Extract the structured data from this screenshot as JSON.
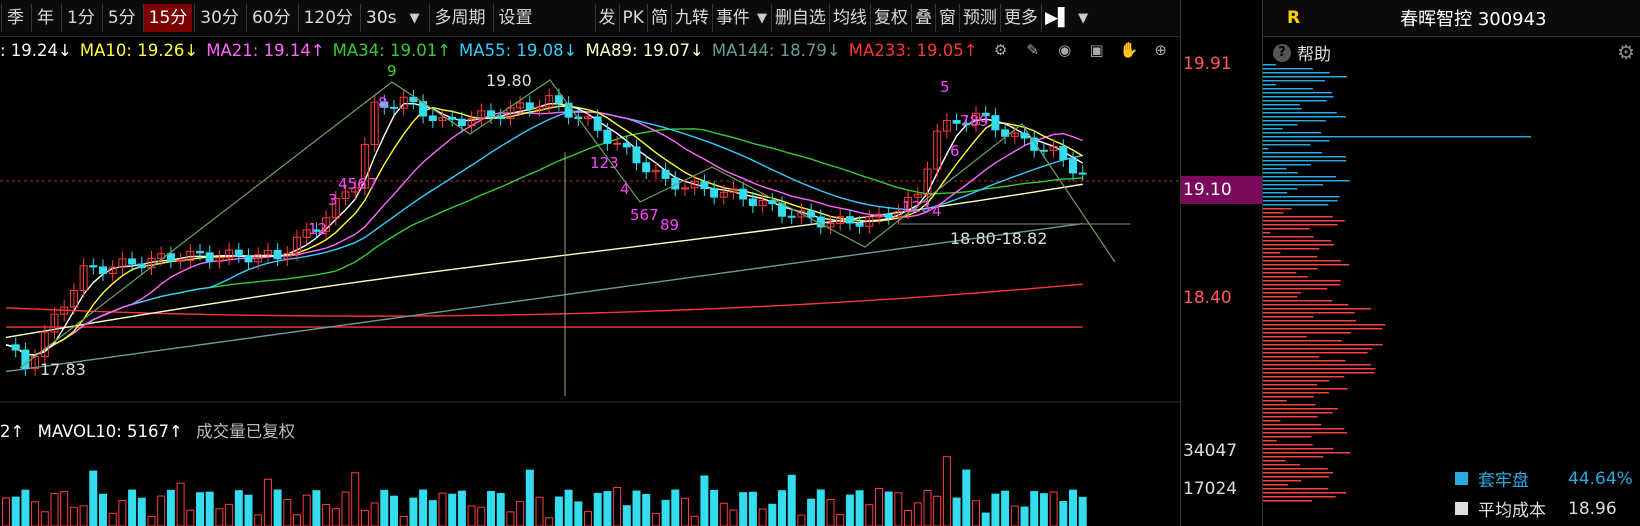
{
  "toolbar": {
    "periods": [
      "季",
      "年",
      "1分",
      "5分",
      "15分",
      "30分",
      "60分",
      "120分",
      "30s"
    ],
    "active_period": "15分",
    "buttons_left": [
      "多周期",
      "设置"
    ],
    "buttons_right": [
      "发",
      "PK",
      "简",
      "九转",
      "事件",
      "删自选",
      "均线",
      "复权",
      "叠",
      "窗",
      "预测",
      "更多"
    ]
  },
  "ma_legend": [
    {
      "label": ": 19.24↓",
      "color": "#ffffff"
    },
    {
      "label": "MA10: 19.26↓",
      "color": "#ffff33"
    },
    {
      "label": "MA21: 19.14↑",
      "color": "#ff66ff"
    },
    {
      "label": "MA34: 19.01↑",
      "color": "#33cc33"
    },
    {
      "label": "MA55: 19.08↓",
      "color": "#33ccff"
    },
    {
      "label": "MA89: 19.07↓",
      "color": "#ffffcc"
    },
    {
      "label": "MA144: 18.79↓",
      "color": "#6a9a9a"
    },
    {
      "label": "MA233: 19.05↑",
      "color": "#ff3333"
    }
  ],
  "chart_icons": [
    "gear-icon",
    "brush-icon",
    "eye-icon",
    "box-icon",
    "hand-icon",
    "plus-circle-icon",
    "minus-circle-icon"
  ],
  "price_axis": {
    "labels": [
      "19.91",
      "19.10",
      "18.40"
    ],
    "current": "19.10"
  },
  "annotations": {
    "high": "19.80",
    "low": "17.83",
    "range": "18.80-18.82",
    "counts_purple": [
      "12",
      "3",
      "456",
      "7",
      "8",
      "123",
      "4",
      "567",
      "89",
      "5",
      "6",
      "789",
      "123",
      "4"
    ],
    "count_green": "9"
  },
  "volume_legend": [
    {
      "label": "2↑",
      "color": "#ffffff"
    },
    {
      "label": "MAVOL10: 5167↑",
      "color": "#ffffff"
    },
    {
      "label": "成交量已复权",
      "color": "#bbbbbb"
    }
  ],
  "volume_axis": {
    "labels": [
      "34047",
      "17024"
    ]
  },
  "right_panel": {
    "badge": "R",
    "title": "春晖智控 300943",
    "help": "帮助",
    "stats": [
      {
        "label": "套牢盘",
        "value": "44.64%",
        "color": "#2aa8e0"
      },
      {
        "label": "平均成本",
        "value": "18.96",
        "color": "#dddddd"
      }
    ]
  },
  "colors": {
    "up": "#ff3b3b",
    "down": "#33ddee",
    "accent": "#7a0000"
  }
}
